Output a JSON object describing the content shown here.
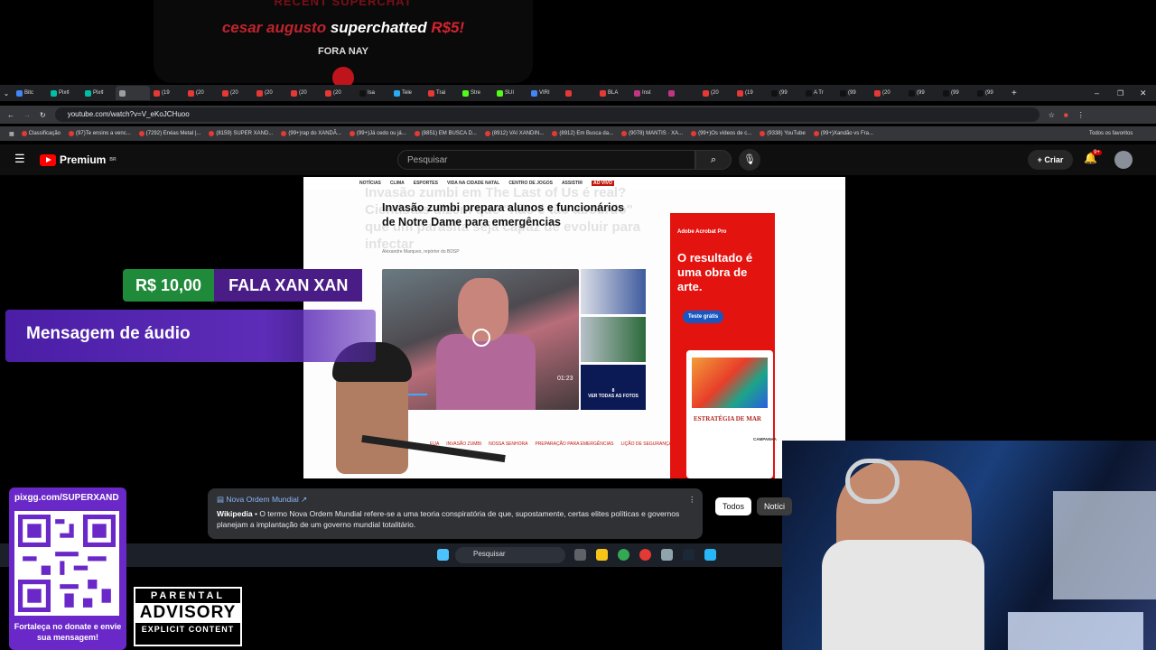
{
  "superchat": {
    "header": "RECENT SUPERCHAT",
    "username": "cesar augusto",
    "action": "superchatted",
    "amount": "R$5!",
    "message": "FORA NAY"
  },
  "browser": {
    "tabs": [
      "Bitc",
      "Pix¢",
      "Pix¢",
      "",
      "(19",
      "(20",
      "(20",
      "(20",
      "(20",
      "(20",
      "Isa",
      "Tele",
      "Trai",
      "Stre",
      "SUI",
      "VIRI",
      "",
      "BLA",
      "Inst",
      "",
      "(20",
      "(19",
      "(99",
      "A Tr",
      "(99",
      "(20",
      "(99",
      "(99",
      "(99"
    ],
    "active_tab_index": 3,
    "url": "youtube.com/watch?v=V_eKoJCHuoo",
    "bookmarks": [
      "Classificação",
      "(97)Te ensino a venc...",
      "(7292) Enéas Metal |...",
      "(8159) SUPER XAND...",
      "(99+)rap do XANDÃ...",
      "(99+)Já cedo ou já...",
      "(8851) EM BUSCA D...",
      "(8912) VAI XANDIN...",
      "(8912) Em Busca da...",
      "(9078) MANTIS · XA...",
      "(99+)Os vídeos de c...",
      "(9338) YouTube",
      "(99+)Xandão vs Fra..."
    ],
    "all_bookmarks_label": "Todos os favoritos"
  },
  "youtube": {
    "logo_text": "Premium",
    "logo_superscript": "BR",
    "search_placeholder": "Pesquisar",
    "create_label": "Criar",
    "notifications_badge": "9+"
  },
  "article": {
    "nav_items": [
      "NOTÍCIAS",
      "CLIMA",
      "ESPORTES",
      "VIDA NA CIDADE NATAL",
      "CENTRO DE JOGOS",
      "ASSISTIR"
    ],
    "live_label": "AO VIVO",
    "ghost_text": "Invasão zumbi em The Last of Us é real? Cientistas dizem que \"não é tão absurdo\" que um parasita seja capaz de evoluir para infectar",
    "title": "Invasão zumbi prepara alunos e funcionários de Notre Dame para emergências",
    "meta": "Alexandre Marques, repórter do BDSP",
    "video_time": "01:23",
    "see_all_count": "8",
    "see_all_label": "VER TODAS AS FOTOS",
    "tags": [
      "EUA",
      "INVASÃO ZUMBI",
      "NOSSA SENHORA",
      "PREPARAÇÃO PARA EMERGÊNCIAS",
      "LIÇÃO DE SEGURANÇA"
    ]
  },
  "ad": {
    "brand": "Adobe Acrobat Pro",
    "headline": "O resultado é uma obra de arte.",
    "button": "Teste grátis",
    "card_title": "ESTRATÉGIA DE MAR",
    "card_sub": "CAMPANHA"
  },
  "donation": {
    "amount": "R$ 10,00",
    "name": "FALA XAN XAN",
    "audio_label": "Mensagem de áudio"
  },
  "wiki": {
    "title": "Nova Ordem Mundial",
    "source": "Wikipedia",
    "text": "O termo Nova Ordem Mundial refere-se a uma teoria conspiratória de que, supostamente, certas elites políticas e governos planejam a implantação de um governo mundial totalitário."
  },
  "filters": [
    "Todos",
    "Notíci"
  ],
  "taskbar": {
    "search_placeholder": "Pesquisar"
  },
  "qr": {
    "url": "pixgg.com/SUPERXAND",
    "footer": "Fortaleça no donate e envie sua mensagem!"
  },
  "advisory": {
    "line1": "PARENTAL",
    "line2": "ADVISORY",
    "line3": "EXPLICIT CONTENT"
  },
  "colors": {
    "donation_green": "#1f8a39",
    "donation_purple": "#4a1c86",
    "yt_red": "#ff0000",
    "ad_red": "#e3130f",
    "qr_purple": "#6a28c8"
  }
}
